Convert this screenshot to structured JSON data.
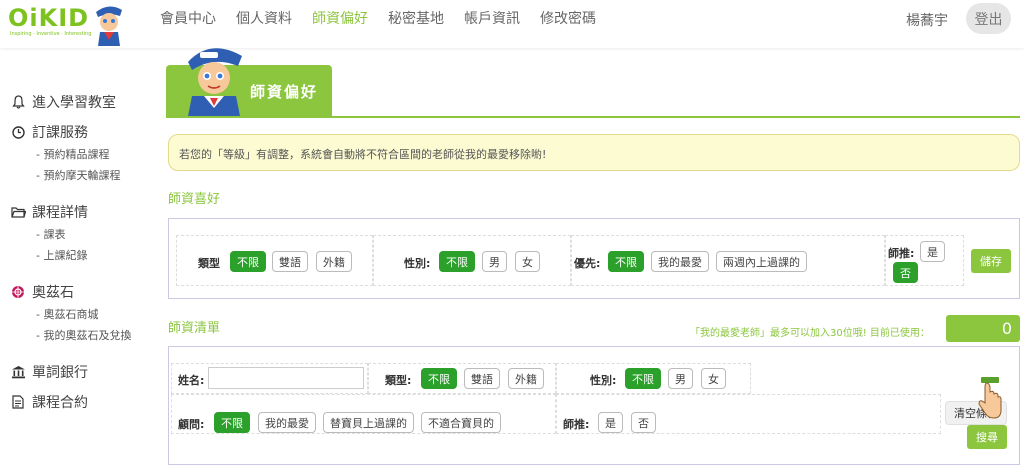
{
  "header": {
    "logo_text": "OiKID",
    "logo_tagline": "Inspiring · Inventive · Interesting",
    "nav": [
      "會員中心",
      "個人資料",
      "師資偏好",
      "秘密基地",
      "帳戶資訊",
      "修改密碼"
    ],
    "active_nav": "師資偏好",
    "user_name": "楊蕎宇",
    "logout_label": "登出"
  },
  "sidebar": {
    "groups": [
      {
        "label": "進入學習教室",
        "icon": "bell-icon",
        "subs": []
      },
      {
        "label": "訂課服務",
        "icon": "clock-icon",
        "subs": [
          "- 預約精品課程",
          "- 預約摩天輪課程"
        ]
      },
      {
        "label": "課程詳情",
        "icon": "folder-icon",
        "subs": [
          "- 課表",
          "- 上課紀錄"
        ]
      },
      {
        "label": "奧茲石",
        "icon": "gem-icon",
        "subs": [
          "- 奧茲石商城",
          "- 我的奧茲石及兌換"
        ]
      },
      {
        "label": "單詞銀行",
        "icon": "bank-icon",
        "subs": []
      },
      {
        "label": "課程合約",
        "icon": "document-icon",
        "subs": []
      }
    ]
  },
  "page": {
    "title": "師資偏好",
    "notice": "若您的「等級」有調整，系統會自動將不符合區間的老師從我的最愛移除喲!"
  },
  "preference": {
    "section_title": "師資喜好",
    "type_label": "類型",
    "type_options": [
      "不限",
      "雙語",
      "外籍"
    ],
    "gender_label": "性別:",
    "gender_options": [
      "不限",
      "男",
      "女"
    ],
    "priority_label": "優先:",
    "priority_options": [
      "不限",
      "我的最愛",
      "兩週內上過課的"
    ],
    "recommend_label": "師推:",
    "recommend_options": [
      "是",
      "否"
    ],
    "save_label": "儲存"
  },
  "list": {
    "section_title": "師資清單",
    "favorite_note": "「我的最愛老師」最多可以加入30位哦! 目前已使用：",
    "favorite_count": "0",
    "name_label": "姓名:",
    "name_value": "",
    "type_label": "類型:",
    "type_options": [
      "不限",
      "雙語",
      "外籍"
    ],
    "gender_label": "性別:",
    "gender_options": [
      "不限",
      "男",
      "女"
    ],
    "advisor_label": "顧問:",
    "advisor_options": [
      "不限",
      "我的最愛",
      "替寶貝上過課的",
      "不適合寶貝的"
    ],
    "recommend_label": "師推:",
    "recommend_options": [
      "是",
      "否"
    ],
    "clear_label": "清空條件",
    "search_label": "搜尋"
  },
  "colors": {
    "brand_green": "#8cc63f",
    "selected_green": "#2ba02b",
    "notice_bg": "#fdfbd2"
  }
}
